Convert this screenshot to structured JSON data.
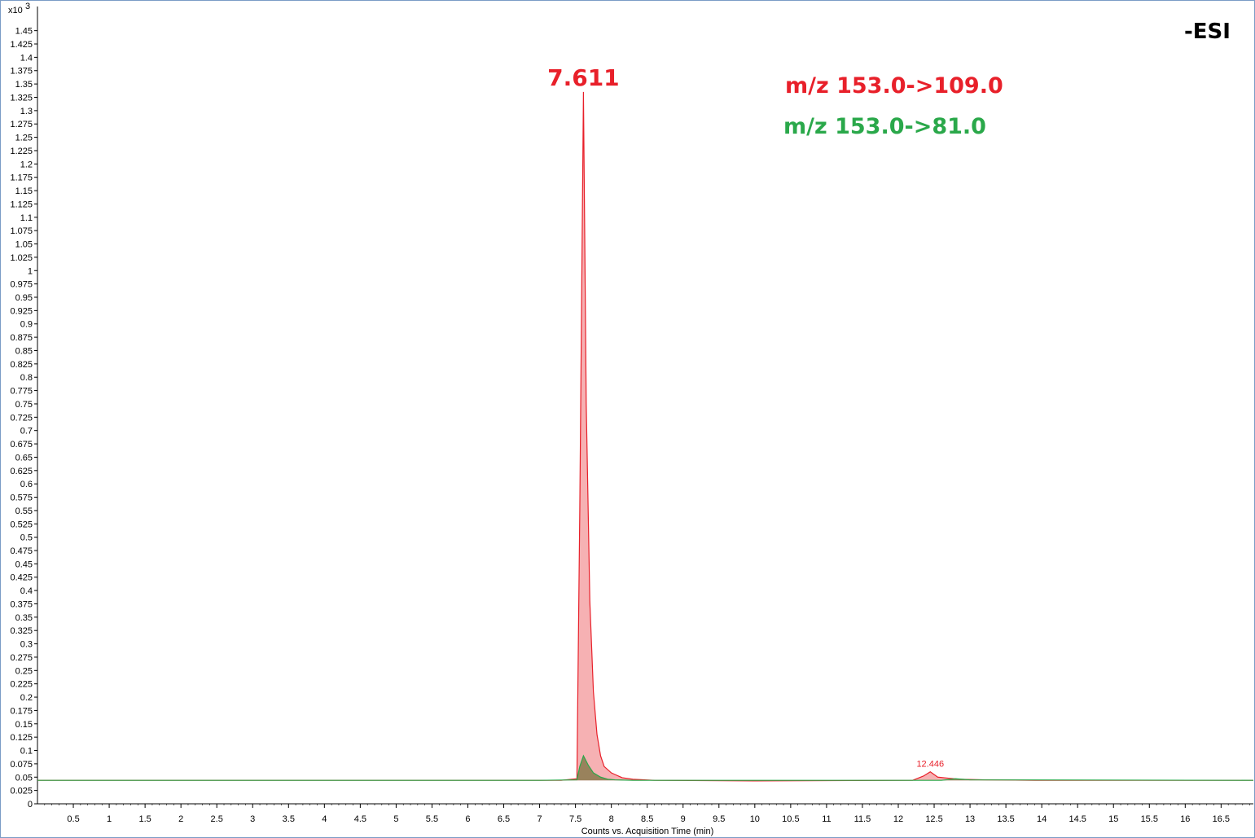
{
  "chart_data": {
    "type": "line",
    "xlabel": "Counts vs. Acquisition Time (min)",
    "y_multiplier": "x10",
    "y_multiplier_exp": "3",
    "xlim": [
      0,
      16.95
    ],
    "ylim": [
      0,
      1.48
    ],
    "x_ticks": [
      "0.5",
      "1",
      "1.5",
      "2",
      "2.5",
      "3",
      "3.5",
      "4",
      "4.5",
      "5",
      "5.5",
      "6",
      "6.5",
      "7",
      "7.5",
      "8",
      "8.5",
      "9",
      "9.5",
      "10",
      "10.5",
      "11",
      "11.5",
      "12",
      "12.5",
      "13",
      "13.5",
      "14",
      "14.5",
      "15",
      "15.5",
      "16",
      "16.5"
    ],
    "y_ticks": [
      "0",
      "0.025",
      "0.05",
      "0.075",
      "0.1",
      "0.125",
      "0.15",
      "0.175",
      "0.2",
      "0.225",
      "0.25",
      "0.275",
      "0.3",
      "0.325",
      "0.35",
      "0.375",
      "0.4",
      "0.425",
      "0.45",
      "0.475",
      "0.5",
      "0.525",
      "0.55",
      "0.575",
      "0.6",
      "0.625",
      "0.65",
      "0.675",
      "0.7",
      "0.725",
      "0.75",
      "0.775",
      "0.8",
      "0.825",
      "0.85",
      "0.875",
      "0.9",
      "0.925",
      "0.95",
      "0.975",
      "1",
      "1.025",
      "1.05",
      "1.075",
      "1.1",
      "1.125",
      "1.15",
      "1.175",
      "1.2",
      "1.225",
      "1.25",
      "1.275",
      "1.3",
      "1.325",
      "1.35",
      "1.375",
      "1.4",
      "1.425",
      "1.45"
    ],
    "series": [
      {
        "name": "m/z 153.0->109.0",
        "color": "#e8202a",
        "fill": "#f5a3a6",
        "x": [
          0,
          2,
          4,
          6,
          7.3,
          7.52,
          7.56,
          7.611,
          7.65,
          7.7,
          7.75,
          7.8,
          7.85,
          7.9,
          8.0,
          8.05,
          8.15,
          8.3,
          8.6,
          10,
          12.2,
          12.35,
          12.446,
          12.55,
          12.7,
          12.85,
          13.2,
          14,
          16.95
        ],
        "y": [
          0.044,
          0.044,
          0.044,
          0.044,
          0.044,
          0.047,
          0.55,
          1.335,
          0.75,
          0.38,
          0.21,
          0.13,
          0.09,
          0.07,
          0.058,
          0.055,
          0.049,
          0.046,
          0.044,
          0.043,
          0.044,
          0.052,
          0.06,
          0.05,
          0.048,
          0.046,
          0.045,
          0.044,
          0.044
        ]
      },
      {
        "name": "m/z 153.0->81.0",
        "color": "#2aa84a",
        "fill": "#8f7d52",
        "x": [
          0,
          7.0,
          7.52,
          7.56,
          7.611,
          7.68,
          7.75,
          7.85,
          7.95,
          8.05,
          8.3,
          12.6,
          12.8,
          13.0,
          16.95
        ],
        "y": [
          0.044,
          0.044,
          0.045,
          0.07,
          0.09,
          0.072,
          0.058,
          0.05,
          0.046,
          0.045,
          0.044,
          0.044,
          0.047,
          0.045,
          0.044
        ]
      }
    ],
    "peak_labels": [
      {
        "x": 7.611,
        "y": 1.335,
        "text": "7.611"
      },
      {
        "x": 12.446,
        "y": 0.06,
        "text": "12.446"
      }
    ],
    "legend": [
      {
        "text": "m/z 153.0->109.0",
        "color": "#e8202a"
      },
      {
        "text": "m/z 153.0->81.0",
        "color": "#2aa84a"
      }
    ],
    "annotation": "-ESI",
    "grid": false
  }
}
